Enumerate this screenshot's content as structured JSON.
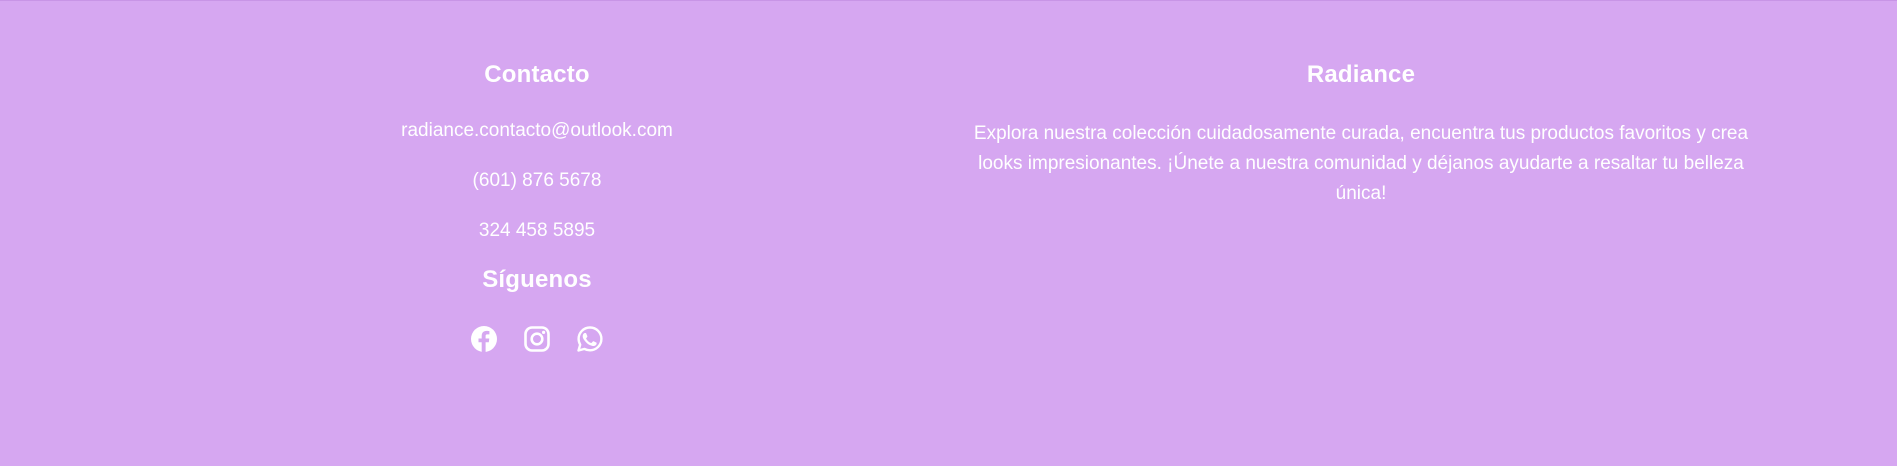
{
  "contact": {
    "title": "Contacto",
    "email": "radiance.contacto@outlook.com",
    "phone_1": "(601) 876 5678",
    "phone_2": "324 458 5895"
  },
  "social": {
    "title": "Síguenos",
    "icons": [
      "facebook-icon",
      "instagram-icon",
      "whatsapp-icon"
    ]
  },
  "brand": {
    "title": "Radiance",
    "description": "Explora nuestra colección cuidadosamente curada, encuentra tus productos favoritos y crea looks impresionantes. ¡Únete a nuestra comunidad y déjanos ayudarte a resaltar tu belleza única!"
  },
  "colors": {
    "background": "#d6a7f1",
    "text": "#ffffff"
  }
}
